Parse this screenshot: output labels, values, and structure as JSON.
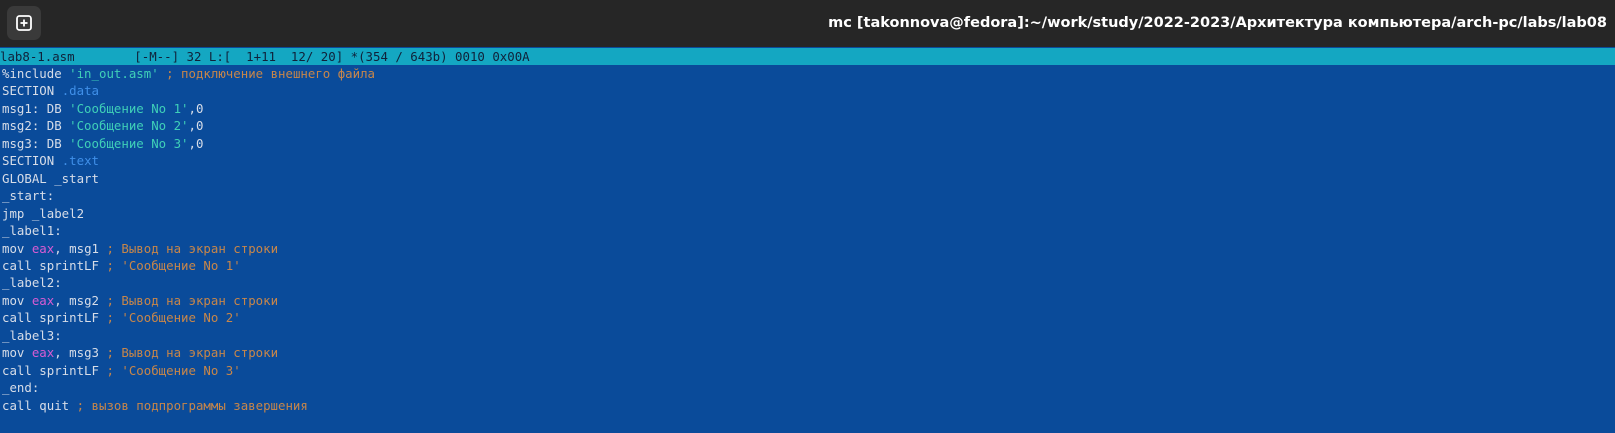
{
  "window": {
    "title": "mc [takonnova@fedora]:~/work/study/2022-2023/Архитектура компьютера/arch-pc/labs/lab08",
    "new_tab_icon": "plus-square-icon"
  },
  "editor": {
    "status_line": "lab8-1.asm        [-M--] 32 L:[  1+11  12/ 20] *(354 / 643b) 0010 0x00A",
    "lines": [
      [
        {
          "t": "code",
          "v": "%include "
        },
        {
          "t": "str",
          "v": "'in_out.asm'"
        },
        {
          "t": "comment",
          "v": " ; подключение внешнего файла"
        }
      ],
      [
        {
          "t": "code",
          "v": "SECTION "
        },
        {
          "t": "section",
          "v": ".data"
        }
      ],
      [
        {
          "t": "code",
          "v": "msg1: DB "
        },
        {
          "t": "str",
          "v": "'Сообщение No 1'"
        },
        {
          "t": "code",
          "v": ",0"
        }
      ],
      [
        {
          "t": "code",
          "v": "msg2: DB "
        },
        {
          "t": "str",
          "v": "'Сообщение No 2'"
        },
        {
          "t": "code",
          "v": ",0"
        }
      ],
      [
        {
          "t": "code",
          "v": "msg3: DB "
        },
        {
          "t": "str",
          "v": "'Сообщение No 3'"
        },
        {
          "t": "code",
          "v": ",0"
        }
      ],
      [
        {
          "t": "code",
          "v": "SECTION "
        },
        {
          "t": "section",
          "v": ".text"
        }
      ],
      [
        {
          "t": "code",
          "v": "GLOBAL _start"
        }
      ],
      [
        {
          "t": "code",
          "v": "_start:"
        }
      ],
      [
        {
          "t": "code",
          "v": "jmp _label2"
        }
      ],
      [
        {
          "t": "code",
          "v": "_label1:"
        }
      ],
      [
        {
          "t": "code",
          "v": "mov "
        },
        {
          "t": "reg",
          "v": "eax"
        },
        {
          "t": "code",
          "v": ", msg1"
        },
        {
          "t": "comment",
          "v": " ; Вывод на экран строки"
        }
      ],
      [
        {
          "t": "code",
          "v": "call sprintLF"
        },
        {
          "t": "comment",
          "v": " ; 'Сообщение No 1'"
        }
      ],
      [
        {
          "t": "code",
          "v": "_label2:"
        }
      ],
      [
        {
          "t": "code",
          "v": "mov "
        },
        {
          "t": "reg",
          "v": "eax"
        },
        {
          "t": "code",
          "v": ", msg2"
        },
        {
          "t": "comment",
          "v": " ; Вывод на экран строки"
        }
      ],
      [
        {
          "t": "code",
          "v": "call sprintLF"
        },
        {
          "t": "comment",
          "v": " ; 'Сообщение No 2'"
        }
      ],
      [
        {
          "t": "code",
          "v": "_label3:"
        }
      ],
      [
        {
          "t": "code",
          "v": "mov "
        },
        {
          "t": "reg",
          "v": "eax"
        },
        {
          "t": "code",
          "v": ", msg3"
        },
        {
          "t": "comment",
          "v": " ; Вывод на экран строки"
        }
      ],
      [
        {
          "t": "code",
          "v": "call sprintLF"
        },
        {
          "t": "comment",
          "v": " ; 'Сообщение No 3'"
        }
      ],
      [
        {
          "t": "code",
          "v": "_end:"
        }
      ],
      [
        {
          "t": "code",
          "v": "call quit"
        },
        {
          "t": "comment",
          "v": " ; вызов подпрограммы завершения"
        }
      ]
    ]
  },
  "colors": {
    "editor_bg": "#0a4b9a",
    "status_bg": "#14a7c2",
    "titlebar_bg": "#262626",
    "text": "#d7dde8",
    "string": "#3fd0b8",
    "comment": "#c7864a",
    "section_keyword": "#3f8fe8",
    "register": "#d85cd3"
  }
}
